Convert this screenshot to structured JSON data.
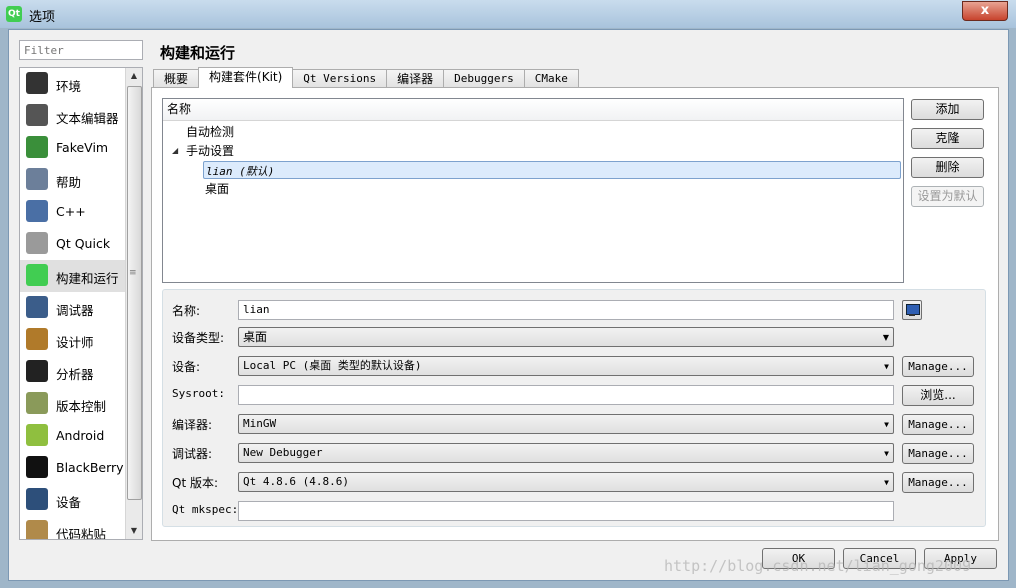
{
  "window": {
    "title": "选项",
    "app_icon": "Qt",
    "close": "x"
  },
  "sidebar": {
    "filter_placeholder": "Filter",
    "items": [
      {
        "label": "环境",
        "icon": "environment-icon",
        "color": "#333333"
      },
      {
        "label": "文本编辑器",
        "icon": "text-editor-icon",
        "color": "#555555"
      },
      {
        "label": "FakeVim",
        "icon": "fakevim-icon",
        "color": "#3a8f3a"
      },
      {
        "label": "帮助",
        "icon": "help-icon",
        "color": "#6c7f9a"
      },
      {
        "label": "C++",
        "icon": "cpp-icon",
        "color": "#4a6fa5"
      },
      {
        "label": "Qt Quick",
        "icon": "qt-quick-icon",
        "color": "#9a9a9a"
      },
      {
        "label": "构建和运行",
        "icon": "build-run-icon",
        "color": "#41cd52"
      },
      {
        "label": "调试器",
        "icon": "debugger-icon",
        "color": "#3b5d8a"
      },
      {
        "label": "设计师",
        "icon": "designer-icon",
        "color": "#b07a2a"
      },
      {
        "label": "分析器",
        "icon": "analyzer-icon",
        "color": "#222222"
      },
      {
        "label": "版本控制",
        "icon": "version-control-icon",
        "color": "#8a9a5a"
      },
      {
        "label": "Android",
        "icon": "android-icon",
        "color": "#8fbf3f"
      },
      {
        "label": "BlackBerry",
        "icon": "blackberry-icon",
        "color": "#111111"
      },
      {
        "label": "设备",
        "icon": "device-icon",
        "color": "#2d4f7a"
      },
      {
        "label": "代码粘贴",
        "icon": "code-paste-icon",
        "color": "#b08a4a"
      }
    ],
    "selected_index": 6
  },
  "page": {
    "title": "构建和运行",
    "tabs": [
      "概要",
      "构建套件(Kit)",
      "Qt Versions",
      "编译器",
      "Debuggers",
      "CMake"
    ],
    "active_tab": 1
  },
  "kits": {
    "header": "名称",
    "auto_detected": "自动检测",
    "manual": "手动设置",
    "selected_kit": "lian (默认)",
    "desktop_kit": "桌面"
  },
  "kit_buttons": {
    "add": "添加",
    "clone": "克隆",
    "remove": "删除",
    "make_default": "设置为默认"
  },
  "details": {
    "name_label": "名称:",
    "name_value": "lian",
    "device_type_label": "设备类型:",
    "device_type_value": "桌面",
    "device_label": "设备:",
    "device_value": "Local PC (桌面 类型的默认设备)",
    "sysroot_label": "Sysroot:",
    "sysroot_value": "",
    "compiler_label": "编译器:",
    "compiler_value": "MinGW",
    "debugger_label": "调试器:",
    "debugger_value": "New Debugger",
    "qt_version_label": "Qt 版本:",
    "qt_version_value": "Qt 4.8.6 (4.8.6)",
    "mkspec_label": "Qt mkspec:",
    "mkspec_value": "",
    "manage": "Manage...",
    "browse": "浏览..."
  },
  "footer": {
    "ok": "OK",
    "cancel": "Cancel",
    "apply": "Apply"
  },
  "watermark": "http://blog.csdn.net/lian_gong2009"
}
